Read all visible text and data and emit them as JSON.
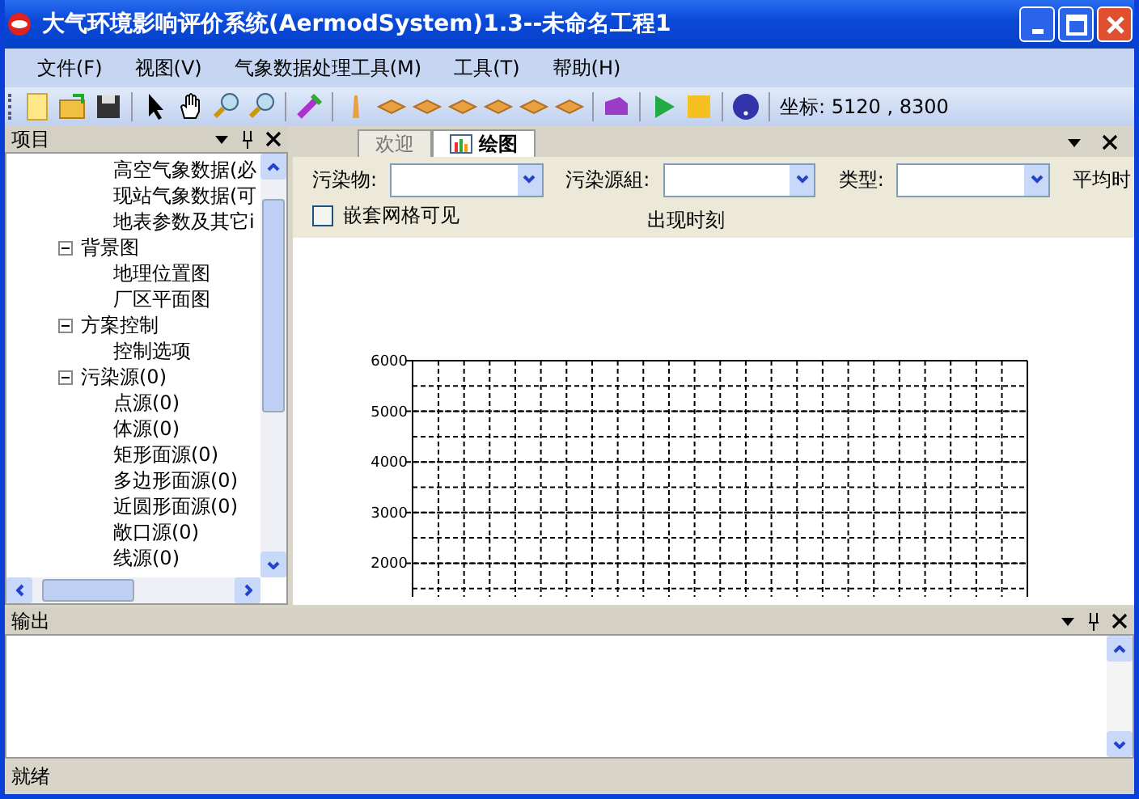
{
  "window": {
    "title": "大气环境影响评价系统(AermodSystem)1.3--未命名工程1"
  },
  "menu": [
    "文件(F)",
    "视图(V)",
    "气象数据处理工具(M)",
    "工具(T)",
    "帮助(H)"
  ],
  "toolbar": {
    "coordinates": "坐标: 5120 , 8300"
  },
  "project_panel": {
    "title": "项目",
    "tree": [
      {
        "children": [
          {
            "label": "高空气象数据(必"
          },
          {
            "label": "现站气象数据(可"
          },
          {
            "label": "地表参数及其它i"
          }
        ]
      },
      {
        "label": "背景图",
        "expanded": true,
        "children": [
          {
            "label": "地理位置图"
          },
          {
            "label": "厂区平面图"
          }
        ]
      },
      {
        "label": "方案控制",
        "expanded": true,
        "children": [
          {
            "label": "控制选项"
          }
        ]
      },
      {
        "label": "污染源(0)",
        "expanded": true,
        "children": [
          {
            "label": "点源(0)"
          },
          {
            "label": "体源(0)"
          },
          {
            "label": "矩形面源(0)"
          },
          {
            "label": "多边形面源(0)"
          },
          {
            "label": "近圆形面源(0)"
          },
          {
            "label": "敞口源(0)"
          },
          {
            "label": "线源(0)"
          }
        ]
      }
    ]
  },
  "tabs": [
    {
      "label": "欢迎",
      "selected": false
    },
    {
      "label": "绘图",
      "selected": true
    }
  ],
  "filters": [
    {
      "label": "污染物:"
    },
    {
      "label": "污染源組:"
    },
    {
      "label": "类型:"
    }
  ],
  "average_time_label": "平均时",
  "nested_grid": {
    "label": "嵌套网格可见",
    "checked": false
  },
  "occurrence_label": "出现时刻",
  "plot": {
    "y_axis_labels": [
      "6000",
      "5000",
      "4000",
      "3000",
      "2000"
    ]
  },
  "output_panel": {
    "title": "输出"
  },
  "status_bar": "就绪"
}
